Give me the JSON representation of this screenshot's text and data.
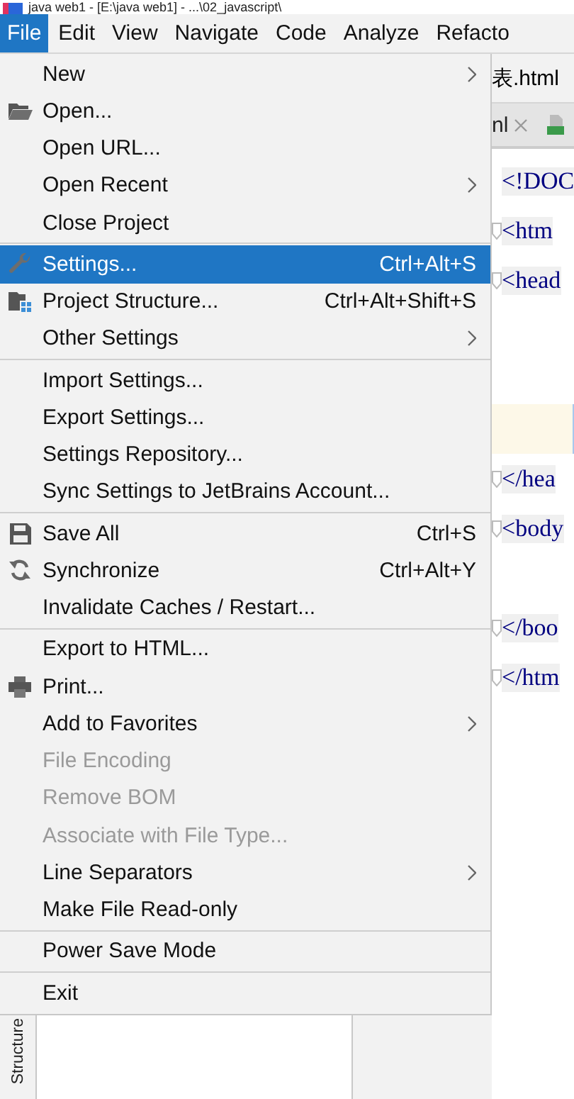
{
  "window": {
    "title": "java web1 - [E:\\java web1] - ...\\02_javascript\\"
  },
  "menubar": [
    {
      "label": "File",
      "selected": true
    },
    {
      "label": "Edit",
      "selected": false
    },
    {
      "label": "View",
      "selected": false
    },
    {
      "label": "Navigate",
      "selected": false
    },
    {
      "label": "Code",
      "selected": false
    },
    {
      "label": "Analyze",
      "selected": false
    },
    {
      "label": "Refacto",
      "selected": false
    }
  ],
  "menu": [
    {
      "kind": "item",
      "label": "New",
      "submenu": true,
      "selected": false,
      "disabled": false
    },
    {
      "kind": "item",
      "label": "Open...",
      "submenu": false,
      "selected": false,
      "disabled": false
    },
    {
      "kind": "item",
      "label": "Open URL...",
      "submenu": false,
      "selected": false,
      "disabled": false
    },
    {
      "kind": "item",
      "label": "Open Recent",
      "submenu": true,
      "selected": false,
      "disabled": false
    },
    {
      "kind": "item",
      "label": "Close Project",
      "submenu": false,
      "selected": false,
      "disabled": false
    },
    {
      "kind": "separator"
    },
    {
      "kind": "item",
      "label": "Settings...",
      "submenu": false,
      "shortcut": "Ctrl+Alt+S",
      "selected": true,
      "disabled": false
    },
    {
      "kind": "item",
      "label": "Project Structure...",
      "submenu": false,
      "shortcut": "Ctrl+Alt+Shift+S",
      "selected": false,
      "disabled": false
    },
    {
      "kind": "item",
      "label": "Other Settings",
      "submenu": true,
      "selected": false,
      "disabled": false
    },
    {
      "kind": "separator"
    },
    {
      "kind": "item",
      "label": "Import Settings...",
      "submenu": false,
      "selected": false,
      "disabled": false
    },
    {
      "kind": "item",
      "label": "Export Settings...",
      "submenu": false,
      "selected": false,
      "disabled": false
    },
    {
      "kind": "item",
      "label": "Settings Repository...",
      "submenu": false,
      "selected": false,
      "disabled": false
    },
    {
      "kind": "item",
      "label": "Sync Settings to JetBrains Account...",
      "submenu": false,
      "selected": false,
      "disabled": false
    },
    {
      "kind": "separator"
    },
    {
      "kind": "item",
      "label": "Save All",
      "submenu": false,
      "shortcut": "Ctrl+S",
      "selected": false,
      "disabled": false
    },
    {
      "kind": "item",
      "label": "Synchronize",
      "submenu": false,
      "shortcut": "Ctrl+Alt+Y",
      "selected": false,
      "disabled": false
    },
    {
      "kind": "item",
      "label": "Invalidate Caches / Restart...",
      "submenu": false,
      "selected": false,
      "disabled": false
    },
    {
      "kind": "separator"
    },
    {
      "kind": "item",
      "label": "Export to HTML...",
      "submenu": false,
      "selected": false,
      "disabled": false
    },
    {
      "kind": "item",
      "label": "Print...",
      "submenu": false,
      "selected": false,
      "disabled": false
    },
    {
      "kind": "item",
      "label": "Add to Favorites",
      "submenu": true,
      "selected": false,
      "disabled": false
    },
    {
      "kind": "item",
      "label": "File Encoding",
      "submenu": false,
      "selected": false,
      "disabled": true
    },
    {
      "kind": "item",
      "label": "Remove BOM",
      "submenu": false,
      "selected": false,
      "disabled": true
    },
    {
      "kind": "item",
      "label": "Associate with File Type...",
      "submenu": false,
      "selected": false,
      "disabled": true
    },
    {
      "kind": "item",
      "label": "Line Separators",
      "submenu": true,
      "selected": false,
      "disabled": false
    },
    {
      "kind": "item",
      "label": "Make File Read-only",
      "submenu": false,
      "selected": false,
      "disabled": false
    },
    {
      "kind": "separator"
    },
    {
      "kind": "item",
      "label": "Power Save Mode",
      "submenu": false,
      "selected": false,
      "disabled": false
    },
    {
      "kind": "separator"
    },
    {
      "kind": "item",
      "label": "Exit",
      "submenu": false,
      "selected": false,
      "disabled": false
    }
  ],
  "side_panel": {
    "tab": "Structure"
  },
  "editor": {
    "file_tab": "表.html",
    "tabs": [
      {
        "label": "nl",
        "closable": true
      }
    ],
    "lines": [
      {
        "kind": "code",
        "text": "<!DOC",
        "fold": false,
        "current": false
      },
      {
        "kind": "code",
        "text": "<htm",
        "fold": true,
        "current": false
      },
      {
        "kind": "code",
        "text": "<head",
        "fold": true,
        "current": false
      },
      {
        "kind": "blank",
        "current": false
      },
      {
        "kind": "blank",
        "current": false
      },
      {
        "kind": "blank",
        "current": true
      },
      {
        "kind": "code",
        "text": "</hea",
        "fold": true,
        "current": false
      },
      {
        "kind": "code",
        "text": "<body",
        "fold": true,
        "current": false
      },
      {
        "kind": "blank",
        "current": false
      },
      {
        "kind": "code",
        "text": "</boo",
        "fold": true,
        "current": false
      },
      {
        "kind": "code",
        "text": "</htm",
        "fold": true,
        "current": false
      }
    ]
  }
}
